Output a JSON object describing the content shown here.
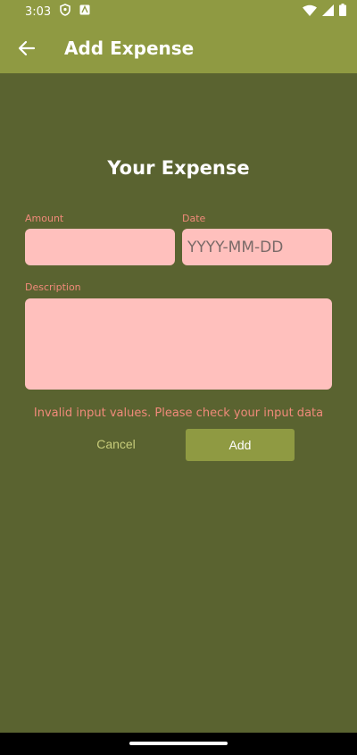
{
  "status_bar": {
    "time": "3:03"
  },
  "app_bar": {
    "title": "Add Expense"
  },
  "form": {
    "title": "Your Expense",
    "amount_label": "Amount",
    "date_label": "Date",
    "date_placeholder": "YYYY-MM-DD",
    "description_label": "Description",
    "error": "Invalid input values. Please check your input data",
    "cancel_label": "Cancel",
    "add_label": "Add"
  },
  "colors": {
    "primary": "#8f9a42",
    "background": "#5a6330",
    "input_fill": "#ffc0bd",
    "error_text": "#f08a7a"
  }
}
